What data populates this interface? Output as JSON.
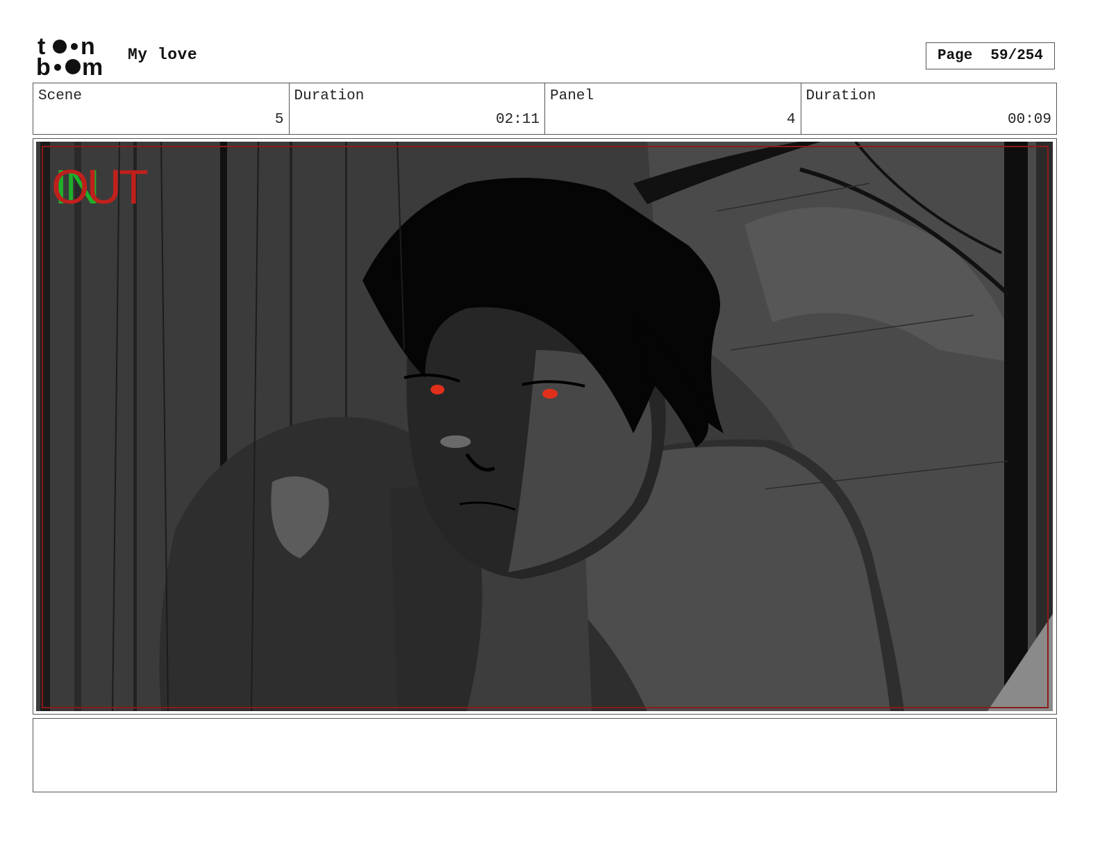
{
  "header": {
    "logo": {
      "name": "toon-boom-logo",
      "line1": "toon",
      "line2": "boom"
    },
    "project_title": "My love",
    "page": {
      "label": "Page",
      "value": "59/254"
    }
  },
  "info": {
    "scene": {
      "label": "Scene",
      "value": "5"
    },
    "scene_duration": {
      "label": "Duration",
      "value": "02:11"
    },
    "panel": {
      "label": "Panel",
      "value": "4"
    },
    "panel_duration": {
      "label": "Duration",
      "value": "00:09"
    }
  },
  "panel_image": {
    "description_icon": "storyboard-sketch-image",
    "overlay_in_text": "IN",
    "overlay_out_text": "OUT",
    "colors": {
      "in": "#1fae2a",
      "out": "#c0201c",
      "safe_frame": "#8b1a1a",
      "eyes": "#e0301c"
    }
  },
  "notes": {
    "text": ""
  }
}
